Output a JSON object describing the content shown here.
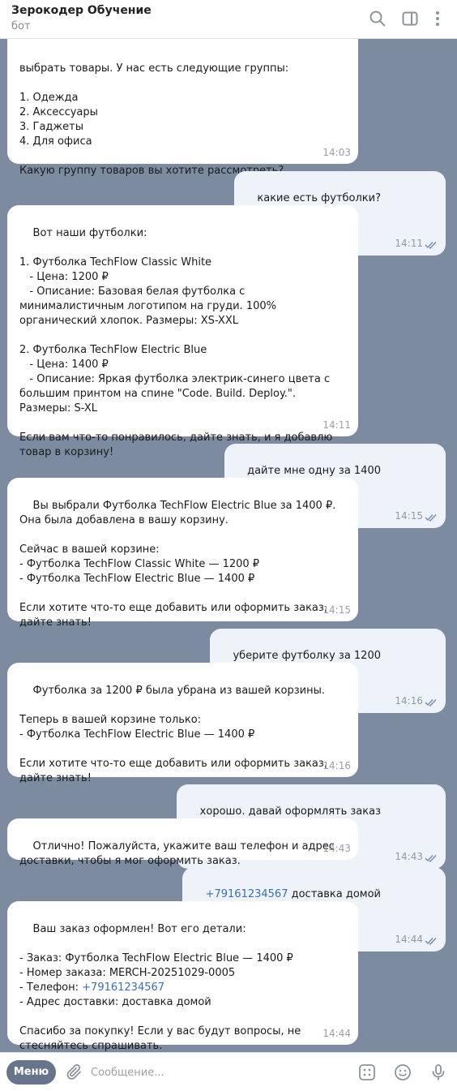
{
  "header": {
    "title": "Зерокодер Обучение",
    "subtitle": "бот"
  },
  "messages": [
    {
      "dir": "in",
      "text": "выбрать товары. У нас есть следующие группы:\n\n1. Одежда\n2. Аксессуары\n3. Гаджеты\n4. Для офиса\n\nКакую группу товаров вы хотите рассмотреть?",
      "time": "14:03"
    },
    {
      "dir": "out",
      "text": "какие есть футболки?",
      "time": "14:11"
    },
    {
      "dir": "in",
      "text": "Вот наши футболки:\n\n1. Футболка TechFlow Classic White\n   - Цена: 1200 ₽\n   - Описание: Базовая белая футболка с минималистичным логотипом на груди. 100% органический хлопок. Размеры: XS-XXL\n\n2. Футболка TechFlow Electric Blue\n   - Цена: 1400 ₽\n   - Описание: Яркая футболка электрик-синего цвета с большим принтом на спине \"Code. Build. Deploy.\". Размеры: S-XL\n\nЕсли вам что-то понравилось, дайте знать, и я добавлю товар в корзину!",
      "time": "14:11"
    },
    {
      "dir": "out",
      "text": "дайте мне одну за 1400",
      "time": "14:15"
    },
    {
      "dir": "in",
      "text": "Вы выбрали Футболка TechFlow Electric Blue за 1400 ₽. Она была добавлена в вашу корзину.\n\nСейчас в вашей корзине:\n- Футболка TechFlow Classic White — 1200 ₽\n- Футболка TechFlow Electric Blue — 1400 ₽\n\nЕсли хотите что-то еще добавить или оформить заказ, дайте знать!",
      "time": "14:15"
    },
    {
      "dir": "out",
      "text": "уберите футболку за 1200",
      "time": "14:16"
    },
    {
      "dir": "in",
      "text": "Футболка за 1200 ₽ была убрана из вашей корзины.\n\nТеперь в вашей корзине только:\n- Футболка TechFlow Electric Blue — 1400 ₽\n\nЕсли хотите что-то еще добавить или оформить заказ, дайте знать!",
      "time": "14:16"
    },
    {
      "dir": "out",
      "text": "хорошо. давай оформлять заказ",
      "time": "14:43"
    },
    {
      "dir": "in",
      "text": "Отлично! Пожалуйста, укажите ваш телефон и адрес доставки, чтобы я мог оформить заказ.",
      "time": "14:43"
    },
    {
      "dir": "out",
      "phone": "+79161234567",
      "text": " доставка домой",
      "time": "14:44"
    },
    {
      "dir": "in",
      "text_before": "Ваш заказ оформлен! Вот его детали:\n\n- Заказ: Футболка TechFlow Electric Blue — 1400 ₽\n- Номер заказа: MERCH-20251029-0005\n- Телефон: ",
      "phone": "+79161234567",
      "text_after": "\n- Адрес доставки: доставка домой\n\nСпасибо за покупку! Если у вас будут вопросы, не стесняйтесь спрашивать.",
      "time": "14:44"
    }
  ],
  "composer": {
    "menu_label": "Меню",
    "placeholder": "Сообщение..."
  },
  "colors": {
    "chat_background": "#7d8ba0",
    "incoming_bubble": "#ffffff",
    "outgoing_bubble": "#eef3fa",
    "menu_button": "#67758c",
    "link": "#3a6fb0"
  }
}
